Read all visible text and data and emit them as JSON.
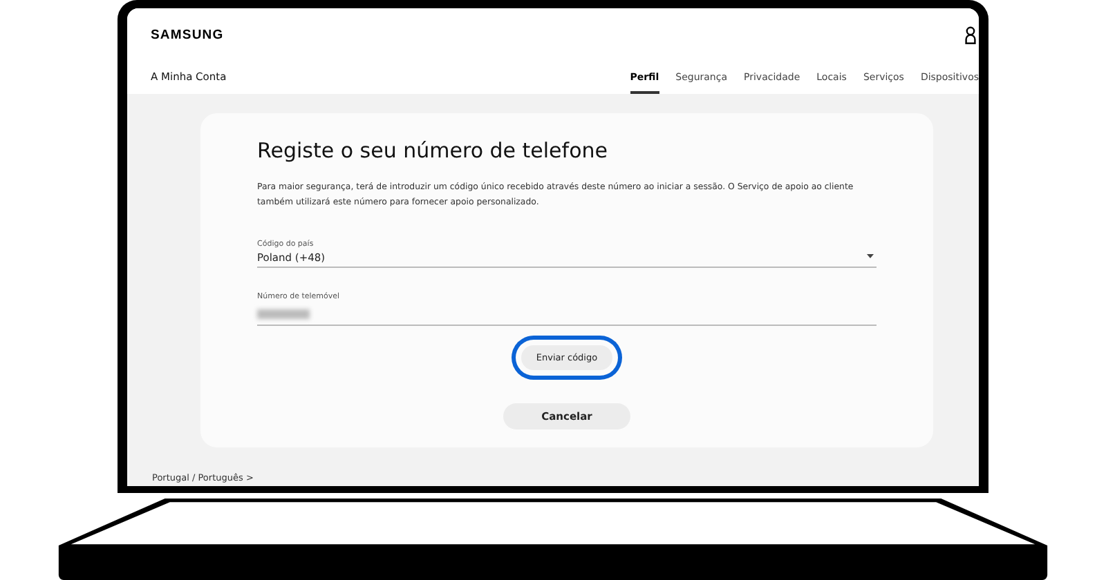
{
  "header": {
    "logo": "SAMSUNG",
    "account_title": "A Minha Conta"
  },
  "tabs": [
    {
      "label": "Perfil",
      "selected": true
    },
    {
      "label": "Segurança",
      "selected": false
    },
    {
      "label": "Privacidade",
      "selected": false
    },
    {
      "label": "Locais",
      "selected": false
    },
    {
      "label": "Serviços",
      "selected": false
    },
    {
      "label": "Dispositivos",
      "selected": false
    }
  ],
  "form": {
    "title": "Registe o seu número de telefone",
    "description": "Para maior segurança, terá de introduzir um código único recebido através deste número ao iniciar a sessão. O Serviço de apoio ao cliente também utilizará este número para fornecer apoio personalizado.",
    "country": {
      "label": "Código do país",
      "value": "Poland (+48)"
    },
    "phone": {
      "label": "Número de telemóvel"
    }
  },
  "buttons": [
    {
      "label": "Enviar código",
      "kind": "primary",
      "focused": true
    },
    {
      "label": "Cancelar",
      "kind": "secondary",
      "focused": false
    }
  ],
  "footer": {
    "language": "Portugal / Português >"
  }
}
